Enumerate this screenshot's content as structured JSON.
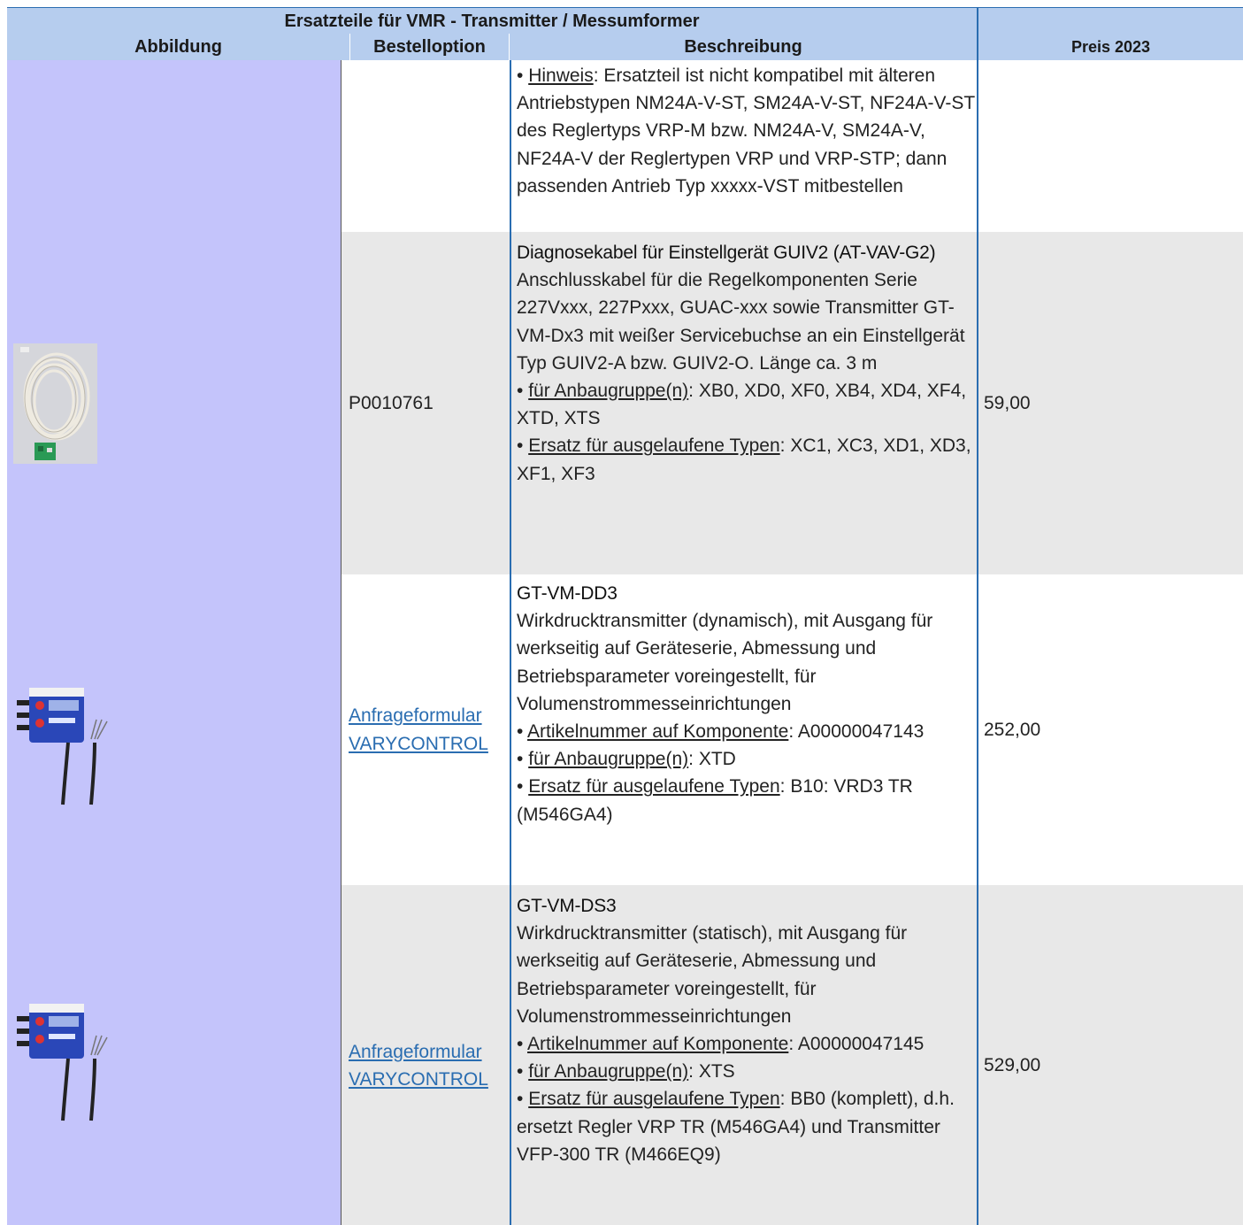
{
  "table": {
    "title": "Ersatzteile für VMR -  Transmitter / Messumformer",
    "headers": {
      "image": "Abbildung",
      "option": "Bestelloption",
      "description": "Beschreibung",
      "price": "Preis 2023"
    },
    "rows": [
      {
        "image_icon": "",
        "option": "",
        "option_links": [],
        "description_title": "",
        "description_lines": [
          {
            "lead": "• ",
            "label": "Hinweis",
            "text": ": Ersatzteil ist nicht kompatibel mit älteren Antriebstypen NM24A-V-ST, SM24A-V-ST, NF24A-V-ST des Reglertyps VRP-M bzw. NM24A-V, SM24A-V, NF24A-V der Reglertypen VRP und VRP-STP; dann passenden Antrieb Typ xxxxx-VST mitbestellen"
          }
        ],
        "price": ""
      },
      {
        "image_icon": "cable-photo-icon",
        "option": "P0010761",
        "option_links": [],
        "description_title": "Diagnosekabel für Einstellgerät GUIV2 (AT-VAV-G2)",
        "description_body": "Anschlusskabel für die Regelkomponenten Serie 227Vxxx, 227Pxxx, GUAC-xxx sowie Transmitter GT-VM-Dx3 mit weißer Servicebuchse an ein Einstellgerät Typ GUIV2-A bzw. GUIV2-O. Länge ca. 3 m",
        "description_lines": [
          {
            "lead": "• ",
            "label": "für Anbaugruppe(n)",
            "text": ": XB0, XD0, XF0, XB4, XD4, XF4, XTD, XTS"
          },
          {
            "lead": "• ",
            "label": "Ersatz für ausgelaufene Typen",
            "text": ": XC1, XC3, XD1, XD3, XF1, XF3"
          }
        ],
        "price": "59,00"
      },
      {
        "image_icon": "transmitter-photo-icon",
        "option": "",
        "option_links": [
          "Anfrageformular",
          "VARYCONTROL"
        ],
        "description_title": "GT-VM-DD3",
        "description_body": "Wirkdrucktransmitter (dynamisch), mit Ausgang für werkseitig auf Geräteserie, Abmessung und Betriebsparameter voreingestellt, für Volumenstrommesseinrichtungen",
        "description_lines": [
          {
            "lead": "• ",
            "label": "Artikelnummer auf Komponente",
            "text": ": A00000047143"
          },
          {
            "lead": "• ",
            "label": "für Anbaugruppe(n)",
            "text": ": XTD"
          },
          {
            "lead": "• ",
            "label": "Ersatz für ausgelaufene Typen",
            "text": ": B10: VRD3 TR (M546GA4)"
          }
        ],
        "price": "252,00"
      },
      {
        "image_icon": "transmitter-photo-icon",
        "option": "",
        "option_links": [
          "Anfrageformular",
          "VARYCONTROL"
        ],
        "description_title": "GT-VM-DS3",
        "description_body": "Wirkdrucktransmitter (statisch), mit Ausgang für werkseitig auf Geräteserie, Abmessung und Betriebsparameter voreingestellt, für Volumenstrommesseinrichtungen",
        "description_lines": [
          {
            "lead": "• ",
            "label": "Artikelnummer auf Komponente",
            "text": ": A00000047145"
          },
          {
            "lead": "• ",
            "label": "für Anbaugruppe(n)",
            "text": ": XTS"
          },
          {
            "lead": "• ",
            "label": "Ersatz für ausgelaufene Typen",
            "text": ": BB0 (komplett), d.h. ersetzt Regler VRP TR (M546GA4) und Transmitter VFP-300 TR (M466EQ9)"
          }
        ],
        "price": "529,00"
      }
    ]
  },
  "colors": {
    "header_bg": "#b6cdee",
    "image_col_bg": "#c4c4fb",
    "alt_row_bg": "#e8e8e8",
    "border_blue": "#2a6db1",
    "link": "#2a6db1"
  }
}
